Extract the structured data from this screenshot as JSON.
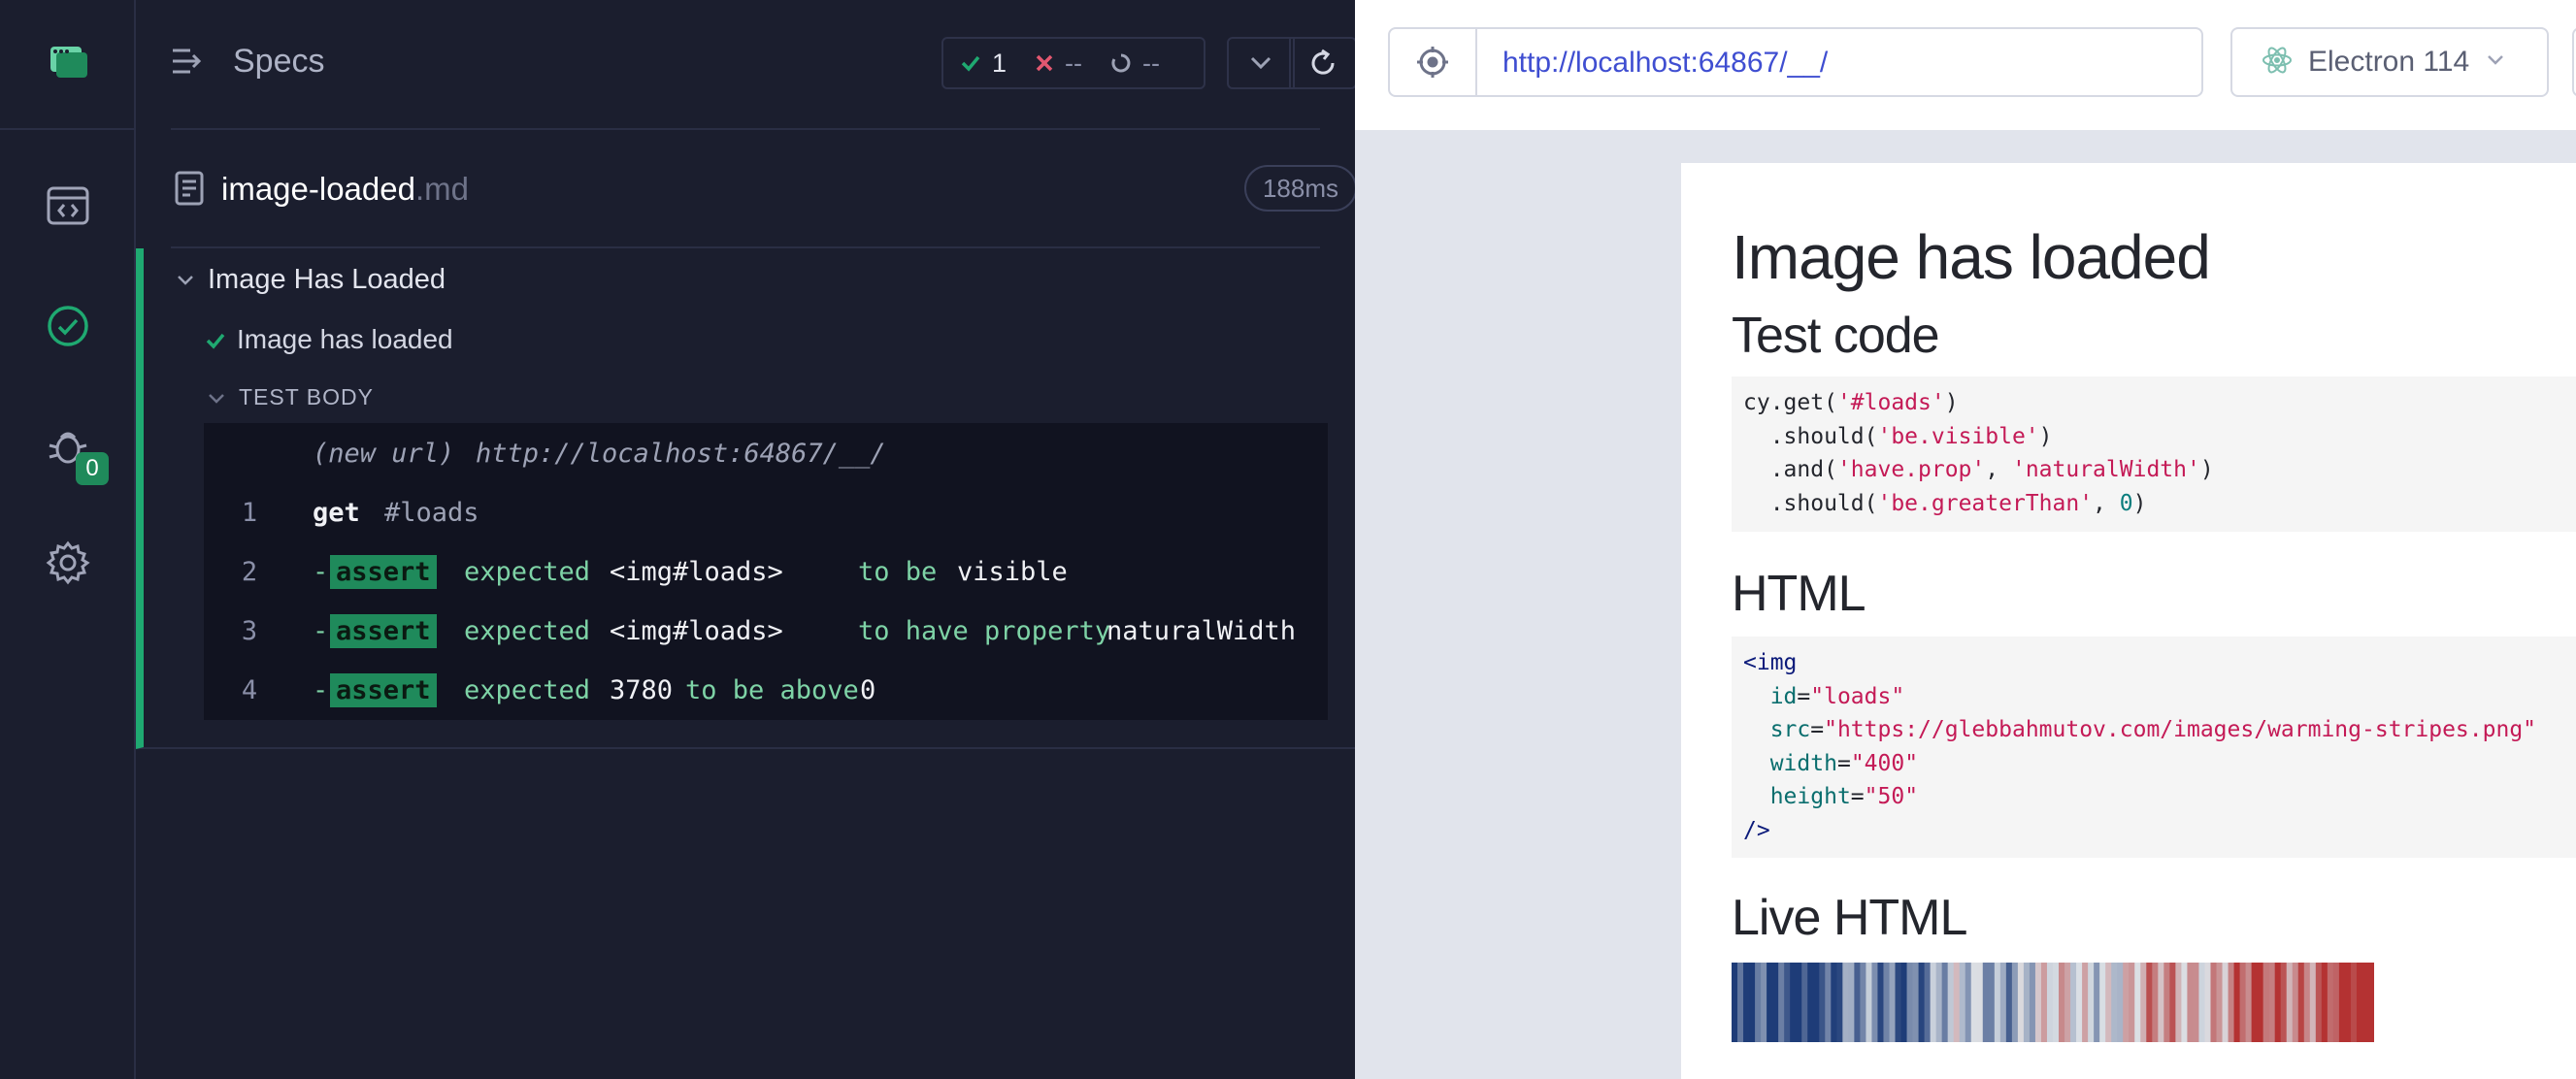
{
  "nav": {
    "items": [
      "specs-icon",
      "runs-icon",
      "debug-icon",
      "settings-icon"
    ],
    "debug_badge": "0"
  },
  "reporter": {
    "title": "Specs",
    "stats": {
      "passed": "1",
      "failed": "--",
      "pending": "--"
    },
    "spec": {
      "name": "image-loaded",
      "ext": ".md",
      "duration": "188ms"
    },
    "suite_title": "Image Has Loaded",
    "test_title": "Image has loaded",
    "body_label": "TEST BODY",
    "commands": {
      "new_url_label": "(new url)",
      "new_url": "http://localhost:64867/__/",
      "c1_num": "1",
      "c1_name": "get",
      "c1_arg": "#loads",
      "c2_num": "2",
      "c2_tag": "assert",
      "c2_a": "expected",
      "c2_b": "<img#loads>",
      "c2_c": "to be",
      "c2_d": "visible",
      "c3_num": "3",
      "c3_tag": "assert",
      "c3_a": "expected",
      "c3_b": "<img#loads>",
      "c3_c": "to have property",
      "c3_d": "naturalWidth",
      "c4_num": "4",
      "c4_tag": "assert",
      "c4_a": "expected",
      "c4_b": "3780",
      "c4_c": "to be above",
      "c4_d": "0"
    }
  },
  "aut": {
    "url": "http://localhost:64867/__/",
    "browser": "Electron 114",
    "page": {
      "h1": "Image has loaded",
      "h2_test": "Test code",
      "h2_html": "HTML",
      "h2_live": "Live HTML",
      "test_code": {
        "l1a": "cy.get(",
        "l1b": "'#loads'",
        "l1c": ")",
        "l2a": "  .should(",
        "l2b": "'be.visible'",
        "l2c": ")",
        "l3a": "  .and(",
        "l3b": "'have.prop'",
        "l3c": ", ",
        "l3d": "'naturalWidth'",
        "l3e": ")",
        "l4a": "  .should(",
        "l4b": "'be.greaterThan'",
        "l4c": ", ",
        "l4d": "0",
        "l4e": ")"
      },
      "html_code": {
        "open": "<img",
        "id_attr": "id",
        "id_val": "\"loads\"",
        "src_attr": "src",
        "src_val": "\"https://glebbahmutov.com/images/warming-stripes.png\"",
        "w_attr": "width",
        "w_val": "\"400\"",
        "h_attr": "height",
        "h_val": "\"50\"",
        "close": "/>"
      }
    }
  },
  "colors": {
    "pass": "#1fa971",
    "fail": "#e45770",
    "link": "#3f4ed1"
  }
}
